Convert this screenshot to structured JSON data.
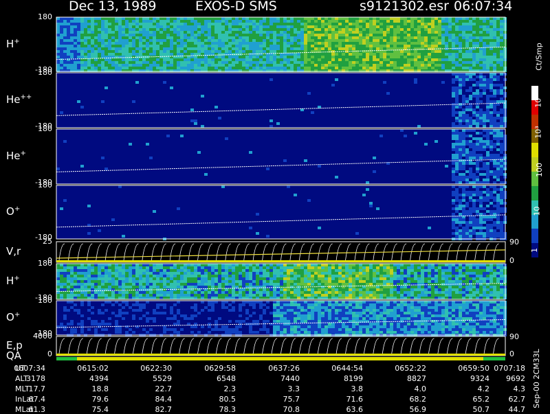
{
  "header": {
    "date": "Dec 13, 1989",
    "instrument": "EXOS-D SMS",
    "file": "s9121302.esr",
    "time": "06:07:34"
  },
  "panels": [
    {
      "base": "H",
      "charge": "+",
      "ytop": "180",
      "ybot": "-180"
    },
    {
      "base": "He",
      "charge": "++",
      "ytop": "180",
      "ybot": "-180"
    },
    {
      "base": "He",
      "charge": "+",
      "ytop": "180",
      "ybot": "-180"
    },
    {
      "base": "O",
      "charge": "+",
      "ytop": "180",
      "ybot": "-180"
    },
    {
      "base": "V,r",
      "charge": "",
      "ytop": "25",
      "ybot": "0",
      "right_top": "90",
      "right_bot": "0"
    },
    {
      "base": "H",
      "charge": "+",
      "ytop": "180",
      "ybot": "-180"
    },
    {
      "base": "O",
      "charge": "+",
      "ytop": "180",
      "ybot": "-180"
    },
    {
      "base": "E,p",
      "charge": "",
      "ytop": "4000",
      "ybot": "0",
      "right_top": "90",
      "right_bot": "0"
    }
  ],
  "qa_label": "QA",
  "colorbar": {
    "unit": "Ct/Smp",
    "ticks": [
      "10⁴",
      "10³",
      "100",
      "10",
      "1"
    ]
  },
  "footer_note": "Sep-00 2CM33L",
  "chart_data": {
    "type": "heatmap",
    "title": "Dec 13, 1989   EXOS-D SMS",
    "row_labels": [
      "UT",
      "ALT",
      "MLT",
      "InLat",
      "MLat"
    ],
    "columns": [
      {
        "UT": "0607:34",
        "ALT": "3178",
        "MLT": "17.7",
        "InLat": "67.4",
        "MLat": "61.3"
      },
      {
        "UT": "0615:02",
        "ALT": "4394",
        "MLT": "18.8",
        "InLat": "79.6",
        "MLat": "75.4"
      },
      {
        "UT": "0622:30",
        "ALT": "5529",
        "MLT": "22.7",
        "InLat": "84.4",
        "MLat": "82.7"
      },
      {
        "UT": "0629:58",
        "ALT": "6548",
        "MLT": "2.3",
        "InLat": "80.5",
        "MLat": "78.3"
      },
      {
        "UT": "0637:26",
        "ALT": "7440",
        "MLT": "3.3",
        "InLat": "75.7",
        "MLat": "70.8"
      },
      {
        "UT": "0644:54",
        "ALT": "8199",
        "MLT": "3.8",
        "InLat": "71.6",
        "MLat": "63.6"
      },
      {
        "UT": "0652:22",
        "ALT": "8827",
        "MLT": "4.0",
        "InLat": "68.2",
        "MLat": "56.9"
      },
      {
        "UT": "0659:50",
        "ALT": "9324",
        "MLT": "4.2",
        "InLat": "65.2",
        "MLat": "50.7"
      },
      {
        "UT": "0707:18",
        "ALT": "9692",
        "MLT": "4.3",
        "InLat": "62.7",
        "MLat": "44.7"
      }
    ],
    "colorscale": [
      "#000a80",
      "#1040c0",
      "#20a0d0",
      "#30c0b0",
      "#20a040",
      "#60c040",
      "#c0d020",
      "#e0e000",
      "#806000",
      "#c03000",
      "#e00000",
      "#ffffff"
    ]
  }
}
